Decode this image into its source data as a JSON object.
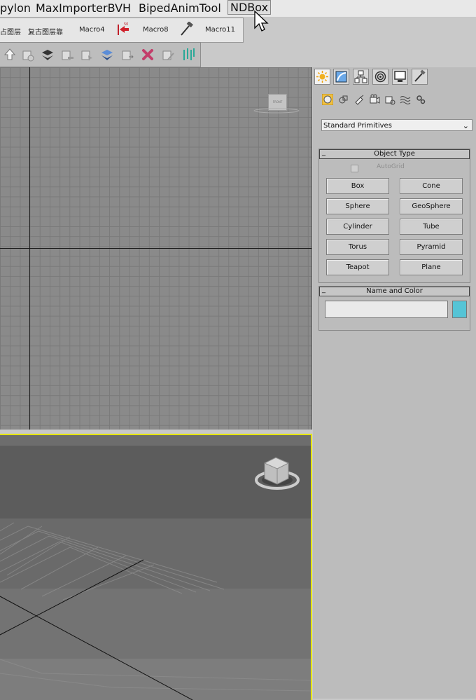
{
  "menubar": {
    "items": [
      "pylon",
      "MaxImporterBVH",
      "BipedAnimTool",
      "NDBox"
    ],
    "active_index": 3
  },
  "macrobar": {
    "items": [
      {
        "label": "占图层",
        "icon": ""
      },
      {
        "label": "复古图层靠",
        "icon": ""
      },
      {
        "label": "Macro4",
        "icon": ""
      },
      {
        "label": "Macro8",
        "icon": "red-arrow-icon"
      },
      {
        "label": "Macro11",
        "icon": "hammer-icon"
      }
    ]
  },
  "layerbar": {
    "icons": [
      "layer-up-icon",
      "layer-add-icon",
      "layers-icon",
      "layer-remove-icon",
      "layer-select-icon",
      "layers-blue-icon",
      "layer-move-icon",
      "delete-icon",
      "layer-edit-icon",
      "columns-icon"
    ]
  },
  "viewport_top": {
    "label": "FRONT"
  },
  "command_panel": {
    "tabs": [
      "create-icon",
      "modify-icon",
      "hierarchy-icon",
      "motion-icon",
      "display-icon",
      "utilities-icon"
    ],
    "categories": [
      "geometry-icon",
      "shapes-icon",
      "lights-icon",
      "cameras-icon",
      "helpers-icon",
      "spacewarps-icon",
      "systems-icon"
    ],
    "dropdown_value": "Standard Primitives",
    "object_type": {
      "title": "Object Type",
      "autogrid_label": "AutoGrid",
      "buttons": [
        "Box",
        "Cone",
        "Sphere",
        "GeoSphere",
        "Cylinder",
        "Tube",
        "Torus",
        "Pyramid",
        "Teapot",
        "Plane"
      ]
    },
    "name_and_color": {
      "title": "Name and Color",
      "name_value": "",
      "color": "#55c4d6"
    }
  }
}
